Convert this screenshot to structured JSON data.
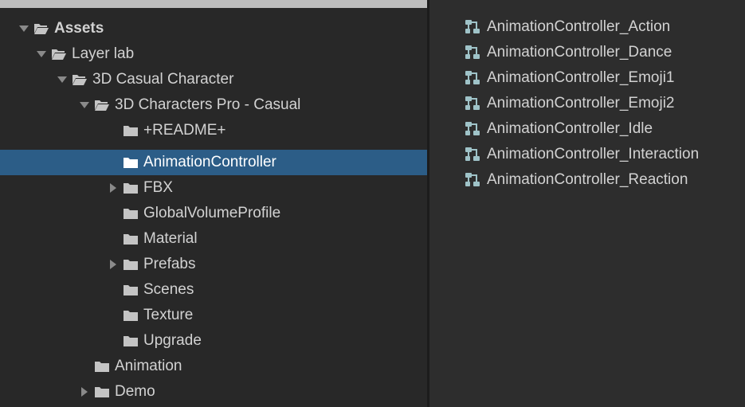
{
  "tree": [
    {
      "label": "Assets",
      "indent": 0,
      "arrow": "down",
      "open": true,
      "bold": true,
      "selected": false
    },
    {
      "label": "Layer lab",
      "indent": 1,
      "arrow": "down",
      "open": true,
      "bold": false,
      "selected": false
    },
    {
      "label": "3D Casual Character",
      "indent": 2,
      "arrow": "down",
      "open": true,
      "bold": false,
      "selected": false
    },
    {
      "label": "3D Characters Pro - Casual",
      "indent": 3,
      "arrow": "down",
      "open": true,
      "bold": false,
      "selected": false
    },
    {
      "label": "+README+",
      "indent": 4,
      "arrow": "none",
      "open": false,
      "bold": false,
      "selected": false
    },
    {
      "label": "AnimationController",
      "indent": 4,
      "arrow": "none",
      "open": false,
      "bold": false,
      "selected": true
    },
    {
      "label": "FBX",
      "indent": 4,
      "arrow": "right",
      "open": false,
      "bold": false,
      "selected": false
    },
    {
      "label": "GlobalVolumeProfile",
      "indent": 4,
      "arrow": "none",
      "open": false,
      "bold": false,
      "selected": false
    },
    {
      "label": "Material",
      "indent": 4,
      "arrow": "none",
      "open": false,
      "bold": false,
      "selected": false
    },
    {
      "label": "Prefabs",
      "indent": 4,
      "arrow": "right",
      "open": false,
      "bold": false,
      "selected": false
    },
    {
      "label": "Scenes",
      "indent": 4,
      "arrow": "none",
      "open": false,
      "bold": false,
      "selected": false
    },
    {
      "label": "Texture",
      "indent": 4,
      "arrow": "none",
      "open": false,
      "bold": false,
      "selected": false
    },
    {
      "label": "Upgrade",
      "indent": 4,
      "arrow": "none",
      "open": false,
      "bold": false,
      "selected": false
    },
    {
      "label": "Animation",
      "indent": 3,
      "arrow": "none",
      "open": false,
      "bold": false,
      "selected": false
    },
    {
      "label": "Demo",
      "indent": 3,
      "arrow": "right",
      "open": false,
      "bold": false,
      "selected": false
    }
  ],
  "assets": [
    "AnimationController_Action",
    "AnimationController_Dance",
    "AnimationController_Emoji1",
    "AnimationController_Emoji2",
    "AnimationController_Idle",
    "AnimationController_Interaction",
    "AnimationController_Reaction"
  ],
  "icons": {
    "folder": "folder-icon",
    "folder_open": "folder-open-icon",
    "asset": "animator-controller-icon"
  },
  "colors": {
    "selection": "#2c5d87",
    "folder": "#c4c4c4",
    "text": "#d2d2d2",
    "asset_icon": "#9fc3c8"
  }
}
